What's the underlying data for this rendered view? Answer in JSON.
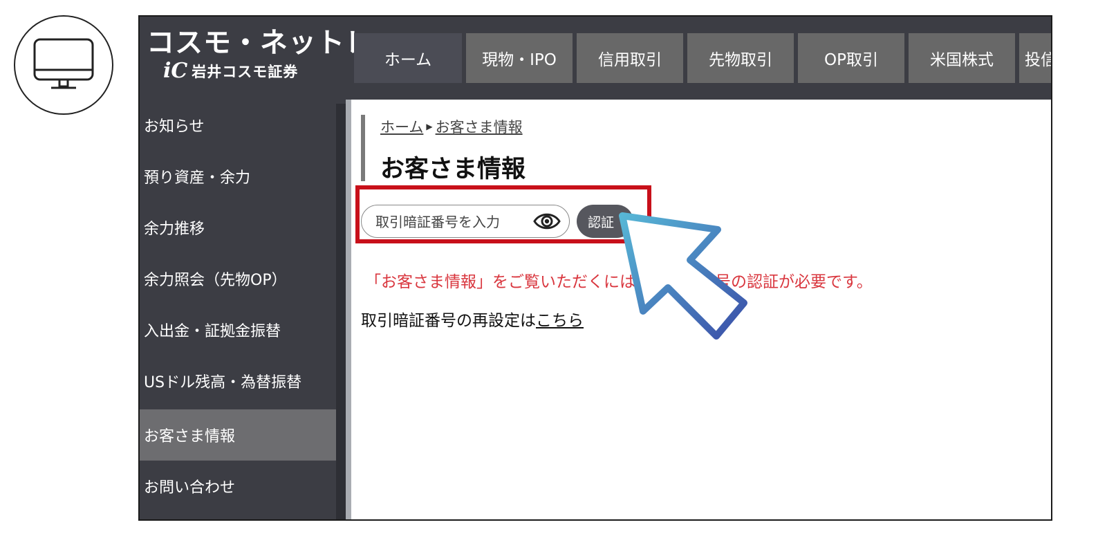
{
  "brand": {
    "name": "コスモ・ネットレ",
    "mark": "iC",
    "company": "岩井コスモ証券"
  },
  "icons": {
    "device": "desktop-monitor-icon",
    "eye": "eye-icon",
    "pointer": "cursor-arrow-icon"
  },
  "nav": {
    "tabs": [
      {
        "label": "ホーム"
      },
      {
        "label": "現物・IPO"
      },
      {
        "label": "信用取引"
      },
      {
        "label": "先物取引"
      },
      {
        "label": "OP取引"
      },
      {
        "label": "米国株式"
      },
      {
        "label": "投信"
      }
    ]
  },
  "sidebar": {
    "items": [
      {
        "label": "お知らせ"
      },
      {
        "label": "預り資産・余力"
      },
      {
        "label": "余力推移"
      },
      {
        "label": "余力照会（先物OP）"
      },
      {
        "label": "入出金・証拠金振替"
      },
      {
        "label": "USドル残高・為替振替"
      },
      {
        "label": "お客さま情報"
      },
      {
        "label": "お問い合わせ"
      }
    ],
    "active_index": 6
  },
  "breadcrumb": {
    "home": "ホーム",
    "current": "お客さま情報"
  },
  "page": {
    "title": "お客さま情報"
  },
  "auth": {
    "placeholder": "取引暗証番号を入力",
    "button_label": "認証"
  },
  "notice": {
    "text": "「お客さま情報」をご覧いただくには取引暗証番号の認証が必要です。"
  },
  "reset": {
    "prefix": "取引暗証番号の再設定は",
    "link": "こちら"
  },
  "colors": {
    "header_bg": "#3c3d44",
    "tab_bg": "#686868",
    "sidebar_active": "#6d6d70",
    "highlight": "#c8101a",
    "notice": "#d9363e",
    "pointer_start": "#57b7d6",
    "pointer_end": "#3b4fa8"
  }
}
